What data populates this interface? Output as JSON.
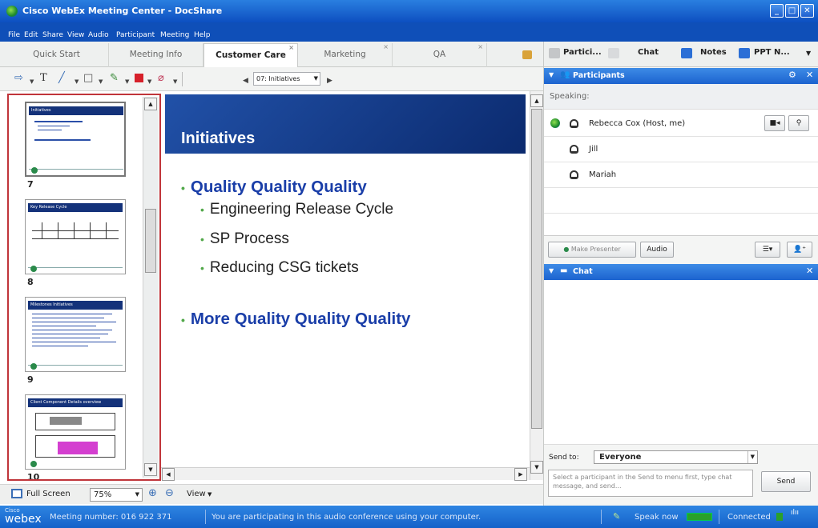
{
  "window": {
    "title": "Cisco WebEx Meeting Center - DocShare"
  },
  "menu": [
    "File",
    "Edit",
    "Share",
    "View",
    "Audio",
    "Participant",
    "Meeting",
    "Help"
  ],
  "tabs": [
    {
      "label": "Quick Start",
      "active": false
    },
    {
      "label": "Meeting Info",
      "active": false
    },
    {
      "label": "Customer Care",
      "active": true
    },
    {
      "label": "Marketing",
      "active": false
    },
    {
      "label": "QA",
      "active": false
    }
  ],
  "toolbar": {
    "page_select": "07: Initiatives"
  },
  "thumbnails": [
    {
      "number": "7",
      "title": "Initiatives"
    },
    {
      "number": "8",
      "title": "Key Release Cycle"
    },
    {
      "number": "9",
      "title": "Milestones Initiatives"
    },
    {
      "number": "10",
      "title": "Client Component Details overview"
    }
  ],
  "slide": {
    "title": "Initiatives",
    "bullets": [
      {
        "text": "Quality Quality Quality",
        "level": 1
      },
      {
        "text": "Engineering Release Cycle",
        "level": 2
      },
      {
        "text": "SP Process",
        "level": 2
      },
      {
        "text": "Reducing CSG tickets",
        "level": 2
      },
      {
        "text": "More Quality Quality Quality",
        "level": 1
      }
    ]
  },
  "bottombar": {
    "fullscreen_label": "Full Screen",
    "zoom": "75%",
    "view_label": "View"
  },
  "status": {
    "brand_small": "Cisco",
    "brand": "webex",
    "meeting_number": "Meeting number: 016 922 371",
    "audio_message": "You are participating in this audio conference using your computer.",
    "speak_now": "Speak now",
    "connected": "Connected"
  },
  "panel_tabs": [
    "Partici...",
    "Chat",
    "Notes",
    "PPT N..."
  ],
  "participants_panel": {
    "title": "Participants",
    "speaking_label": "Speaking:",
    "people": [
      "Rebecca Cox (Host, me)",
      "Jill",
      "Mariah"
    ],
    "make_presenter": "Make Presenter",
    "audio_button": "Audio"
  },
  "chat_panel": {
    "title": "Chat",
    "send_to_label": "Send to:",
    "send_to_value": "Everyone",
    "input_placeholder": "Select a participant in the Send to menu first, type chat message, and send...",
    "send_button": "Send"
  },
  "colors": {
    "accent": "#1c63cf",
    "slide_blue": "#1a3ea8",
    "thumb_border": "#c0353a"
  }
}
